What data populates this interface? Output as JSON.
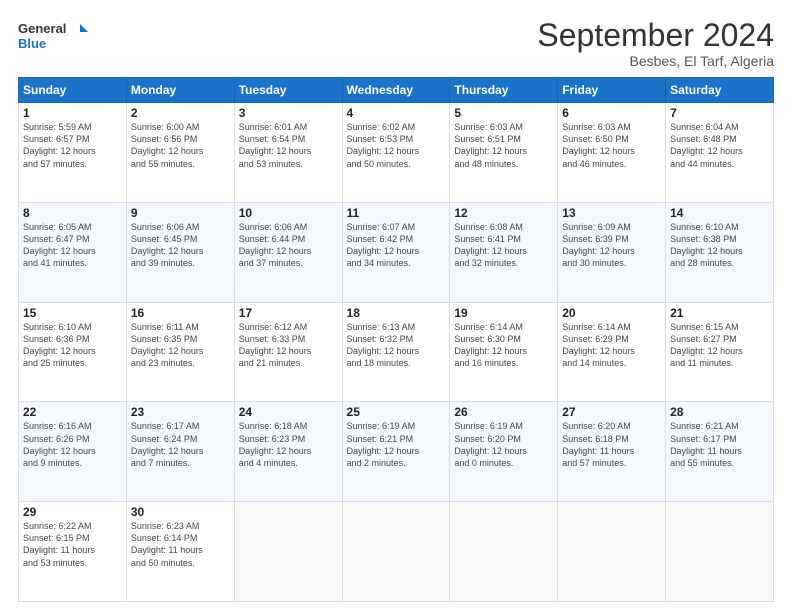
{
  "logo": {
    "line1": "General",
    "line2": "Blue"
  },
  "title": "September 2024",
  "subtitle": "Besbes, El Tarf, Algeria",
  "days_header": [
    "Sunday",
    "Monday",
    "Tuesday",
    "Wednesday",
    "Thursday",
    "Friday",
    "Saturday"
  ],
  "weeks": [
    [
      {
        "num": "1",
        "info": "Sunrise: 5:59 AM\nSunset: 6:57 PM\nDaylight: 12 hours\nand 57 minutes."
      },
      {
        "num": "2",
        "info": "Sunrise: 6:00 AM\nSunset: 6:56 PM\nDaylight: 12 hours\nand 55 minutes."
      },
      {
        "num": "3",
        "info": "Sunrise: 6:01 AM\nSunset: 6:54 PM\nDaylight: 12 hours\nand 53 minutes."
      },
      {
        "num": "4",
        "info": "Sunrise: 6:02 AM\nSunset: 6:53 PM\nDaylight: 12 hours\nand 50 minutes."
      },
      {
        "num": "5",
        "info": "Sunrise: 6:03 AM\nSunset: 6:51 PM\nDaylight: 12 hours\nand 48 minutes."
      },
      {
        "num": "6",
        "info": "Sunrise: 6:03 AM\nSunset: 6:50 PM\nDaylight: 12 hours\nand 46 minutes."
      },
      {
        "num": "7",
        "info": "Sunrise: 6:04 AM\nSunset: 6:48 PM\nDaylight: 12 hours\nand 44 minutes."
      }
    ],
    [
      {
        "num": "8",
        "info": "Sunrise: 6:05 AM\nSunset: 6:47 PM\nDaylight: 12 hours\nand 41 minutes."
      },
      {
        "num": "9",
        "info": "Sunrise: 6:06 AM\nSunset: 6:45 PM\nDaylight: 12 hours\nand 39 minutes."
      },
      {
        "num": "10",
        "info": "Sunrise: 6:06 AM\nSunset: 6:44 PM\nDaylight: 12 hours\nand 37 minutes."
      },
      {
        "num": "11",
        "info": "Sunrise: 6:07 AM\nSunset: 6:42 PM\nDaylight: 12 hours\nand 34 minutes."
      },
      {
        "num": "12",
        "info": "Sunrise: 6:08 AM\nSunset: 6:41 PM\nDaylight: 12 hours\nand 32 minutes."
      },
      {
        "num": "13",
        "info": "Sunrise: 6:09 AM\nSunset: 6:39 PM\nDaylight: 12 hours\nand 30 minutes."
      },
      {
        "num": "14",
        "info": "Sunrise: 6:10 AM\nSunset: 6:38 PM\nDaylight: 12 hours\nand 28 minutes."
      }
    ],
    [
      {
        "num": "15",
        "info": "Sunrise: 6:10 AM\nSunset: 6:36 PM\nDaylight: 12 hours\nand 25 minutes."
      },
      {
        "num": "16",
        "info": "Sunrise: 6:11 AM\nSunset: 6:35 PM\nDaylight: 12 hours\nand 23 minutes."
      },
      {
        "num": "17",
        "info": "Sunrise: 6:12 AM\nSunset: 6:33 PM\nDaylight: 12 hours\nand 21 minutes."
      },
      {
        "num": "18",
        "info": "Sunrise: 6:13 AM\nSunset: 6:32 PM\nDaylight: 12 hours\nand 18 minutes."
      },
      {
        "num": "19",
        "info": "Sunrise: 6:14 AM\nSunset: 6:30 PM\nDaylight: 12 hours\nand 16 minutes."
      },
      {
        "num": "20",
        "info": "Sunrise: 6:14 AM\nSunset: 6:29 PM\nDaylight: 12 hours\nand 14 minutes."
      },
      {
        "num": "21",
        "info": "Sunrise: 6:15 AM\nSunset: 6:27 PM\nDaylight: 12 hours\nand 11 minutes."
      }
    ],
    [
      {
        "num": "22",
        "info": "Sunrise: 6:16 AM\nSunset: 6:26 PM\nDaylight: 12 hours\nand 9 minutes."
      },
      {
        "num": "23",
        "info": "Sunrise: 6:17 AM\nSunset: 6:24 PM\nDaylight: 12 hours\nand 7 minutes."
      },
      {
        "num": "24",
        "info": "Sunrise: 6:18 AM\nSunset: 6:23 PM\nDaylight: 12 hours\nand 4 minutes."
      },
      {
        "num": "25",
        "info": "Sunrise: 6:19 AM\nSunset: 6:21 PM\nDaylight: 12 hours\nand 2 minutes."
      },
      {
        "num": "26",
        "info": "Sunrise: 6:19 AM\nSunset: 6:20 PM\nDaylight: 12 hours\nand 0 minutes."
      },
      {
        "num": "27",
        "info": "Sunrise: 6:20 AM\nSunset: 6:18 PM\nDaylight: 11 hours\nand 57 minutes."
      },
      {
        "num": "28",
        "info": "Sunrise: 6:21 AM\nSunset: 6:17 PM\nDaylight: 11 hours\nand 55 minutes."
      }
    ],
    [
      {
        "num": "29",
        "info": "Sunrise: 6:22 AM\nSunset: 6:15 PM\nDaylight: 11 hours\nand 53 minutes."
      },
      {
        "num": "30",
        "info": "Sunrise: 6:23 AM\nSunset: 6:14 PM\nDaylight: 11 hours\nand 50 minutes."
      },
      null,
      null,
      null,
      null,
      null
    ]
  ]
}
